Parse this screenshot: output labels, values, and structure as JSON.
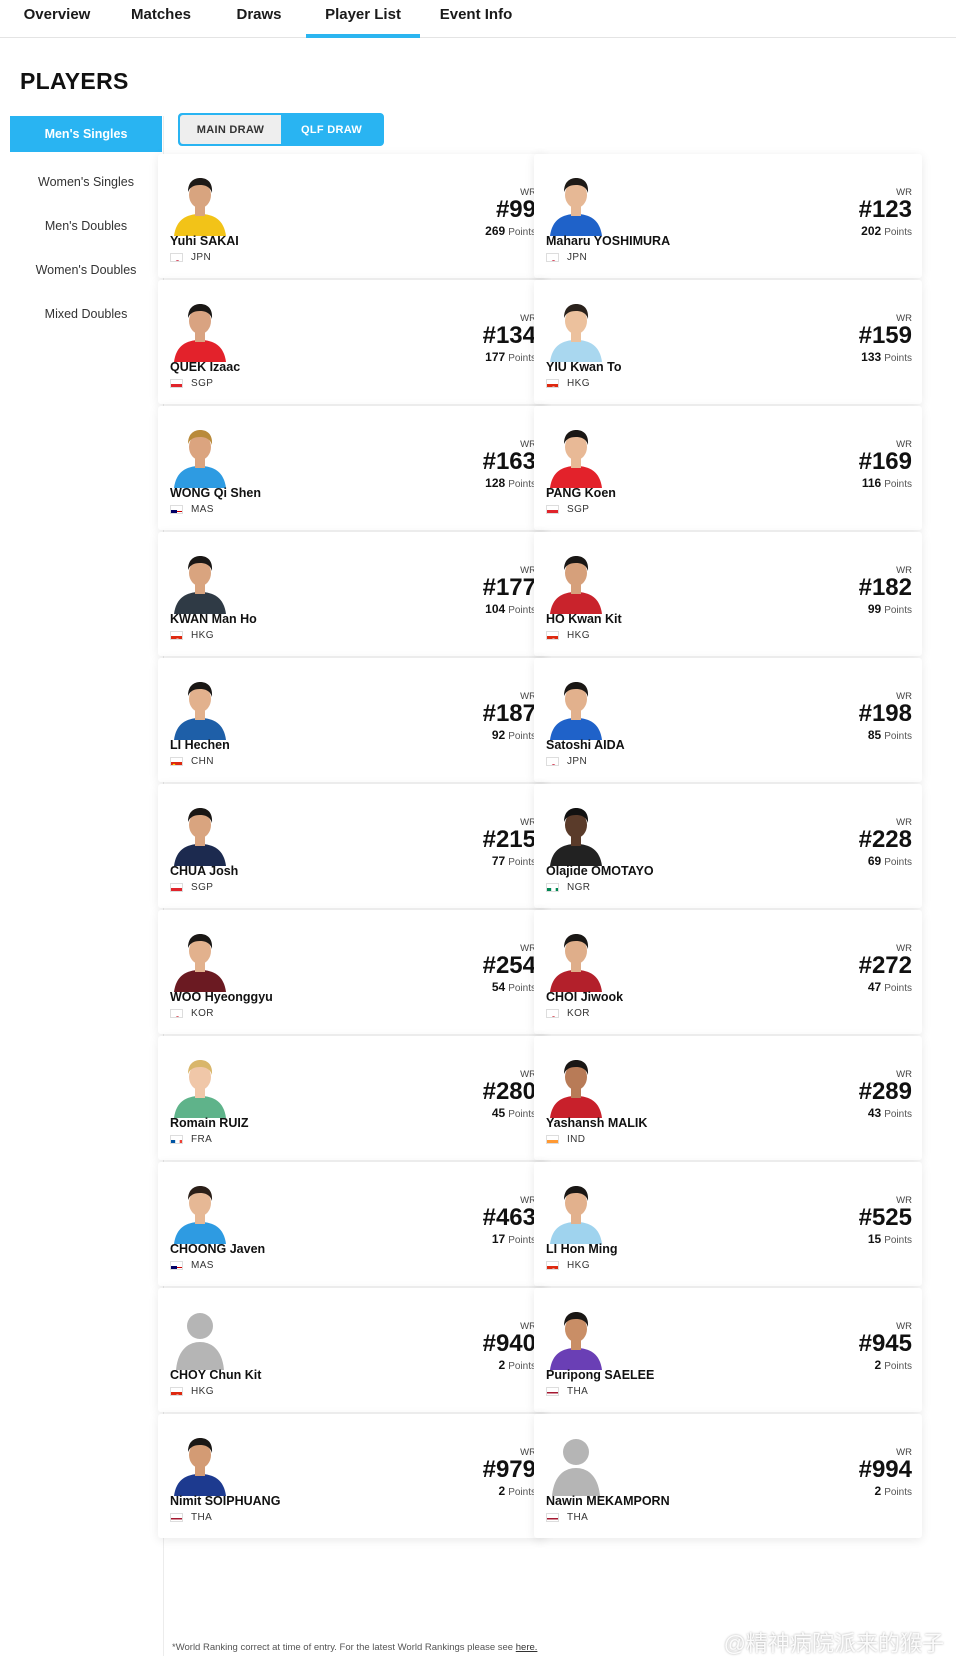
{
  "nav": {
    "tabs": [
      {
        "label": "Overview"
      },
      {
        "label": "Matches"
      },
      {
        "label": "Draws"
      },
      {
        "label": "Player List"
      },
      {
        "label": "Event Info"
      }
    ],
    "active_tab": "Player List"
  },
  "page": {
    "title": "PLAYERS"
  },
  "sidebar": {
    "items": [
      {
        "label": "Men's Singles"
      },
      {
        "label": "Women's Singles"
      },
      {
        "label": "Men's Doubles"
      },
      {
        "label": "Women's Doubles"
      },
      {
        "label": "Mixed Doubles"
      }
    ],
    "active_item": "Men's Singles"
  },
  "draw_toggle": {
    "main_label": "MAIN DRAW",
    "qlf_label": "QLF DRAW",
    "active": "QLF DRAW"
  },
  "colors": {
    "accent": "#29b4f2",
    "text": "#111111"
  },
  "wr_label": "WR",
  "points_label": "Points",
  "players": [
    {
      "name": "Yuhi SAKAI",
      "country": "JPN",
      "rank": "#99",
      "points": "269",
      "jersey": "#f2c318",
      "skin": "#d8a47f",
      "hair": "#1e1a17"
    },
    {
      "name": "Maharu YOSHIMURA",
      "country": "JPN",
      "rank": "#123",
      "points": "202",
      "jersey": "#1f62c9",
      "skin": "#e6b895",
      "hair": "#1e1a17"
    },
    {
      "name": "QUEK Izaac",
      "country": "SGP",
      "rank": "#134",
      "points": "177",
      "jersey": "#e3222b",
      "skin": "#d9a381",
      "hair": "#1a1715"
    },
    {
      "name": "YIU Kwan To",
      "country": "HKG",
      "rank": "#159",
      "points": "133",
      "jersey": "#a9d7ef",
      "skin": "#ecc19d",
      "hair": "#2a221c"
    },
    {
      "name": "WONG Qi Shen",
      "country": "MAS",
      "rank": "#163",
      "points": "128",
      "jersey": "#2e9be2",
      "skin": "#dba47f",
      "hair": "#b98a3a"
    },
    {
      "name": "PANG Koen",
      "country": "SGP",
      "rank": "#169",
      "points": "116",
      "jersey": "#e3222b",
      "skin": "#e8b996",
      "hair": "#1a1715"
    },
    {
      "name": "KWAN Man Ho",
      "country": "HKG",
      "rank": "#177",
      "points": "104",
      "jersey": "#2f3a45",
      "skin": "#d9a47f",
      "hair": "#1a1715"
    },
    {
      "name": "HO Kwan Kit",
      "country": "HKG",
      "rank": "#182",
      "points": "99",
      "jersey": "#c9232c",
      "skin": "#d6a07b",
      "hair": "#1a1715"
    },
    {
      "name": "LI Hechen",
      "country": "CHN",
      "rank": "#187",
      "points": "92",
      "jersey": "#1e5fa8",
      "skin": "#e2b18d",
      "hair": "#1a1715"
    },
    {
      "name": "Satoshi AIDA",
      "country": "JPN",
      "rank": "#198",
      "points": "85",
      "jersey": "#1f62c9",
      "skin": "#e2b18d",
      "hair": "#1a1715"
    },
    {
      "name": "CHUA Josh",
      "country": "SGP",
      "rank": "#215",
      "points": "77",
      "jersey": "#1c2a4f",
      "skin": "#d9a47f",
      "hair": "#1a1715"
    },
    {
      "name": "Olajide OMOTAYO",
      "country": "NGR",
      "rank": "#228",
      "points": "69",
      "jersey": "#222222",
      "skin": "#5a3b2a",
      "hair": "#111111"
    },
    {
      "name": "WOO Hyeonggyu",
      "country": "KOR",
      "rank": "#254",
      "points": "54",
      "jersey": "#6b1a22",
      "skin": "#e2b18d",
      "hair": "#1a1715"
    },
    {
      "name": "CHOI Jiwook",
      "country": "KOR",
      "rank": "#272",
      "points": "47",
      "jersey": "#b3202b",
      "skin": "#dfae8a",
      "hair": "#1a1715"
    },
    {
      "name": "Romain RUIZ",
      "country": "FRA",
      "rank": "#280",
      "points": "45",
      "jersey": "#5fb38a",
      "skin": "#f0c7a8",
      "hair": "#d9b66a"
    },
    {
      "name": "Yashansh MALIK",
      "country": "IND",
      "rank": "#289",
      "points": "43",
      "jersey": "#c8202b",
      "skin": "#b87b57",
      "hair": "#1a1715"
    },
    {
      "name": "CHOONG Javen",
      "country": "MAS",
      "rank": "#463",
      "points": "17",
      "jersey": "#2e9be2",
      "skin": "#e6b895",
      "hair": "#2b1f18"
    },
    {
      "name": "LI Hon Ming",
      "country": "HKG",
      "rank": "#525",
      "points": "15",
      "jersey": "#9fd3ee",
      "skin": "#e2b18d",
      "hair": "#1a1715"
    },
    {
      "name": "CHOY Chun Kit",
      "country": "HKG",
      "rank": "#940",
      "points": "2",
      "placeholder": true
    },
    {
      "name": "Puripong SAELEE",
      "country": "THA",
      "rank": "#945",
      "points": "2",
      "jersey": "#6a3fb5",
      "skin": "#c98e66",
      "hair": "#1a1715"
    },
    {
      "name": "Nimit SOIPHUANG",
      "country": "THA",
      "rank": "#979",
      "points": "2",
      "jersey": "#1d3a8f",
      "skin": "#d39b74",
      "hair": "#1a1715"
    },
    {
      "name": "Nawin MEKAMPORN",
      "country": "THA",
      "rank": "#994",
      "points": "2",
      "placeholder": true
    }
  ],
  "footnote": {
    "text": "*World Ranking correct at time of entry. For the latest World Rankings please see ",
    "link_label": "here."
  },
  "watermark": "@精神病院派来的猴子"
}
